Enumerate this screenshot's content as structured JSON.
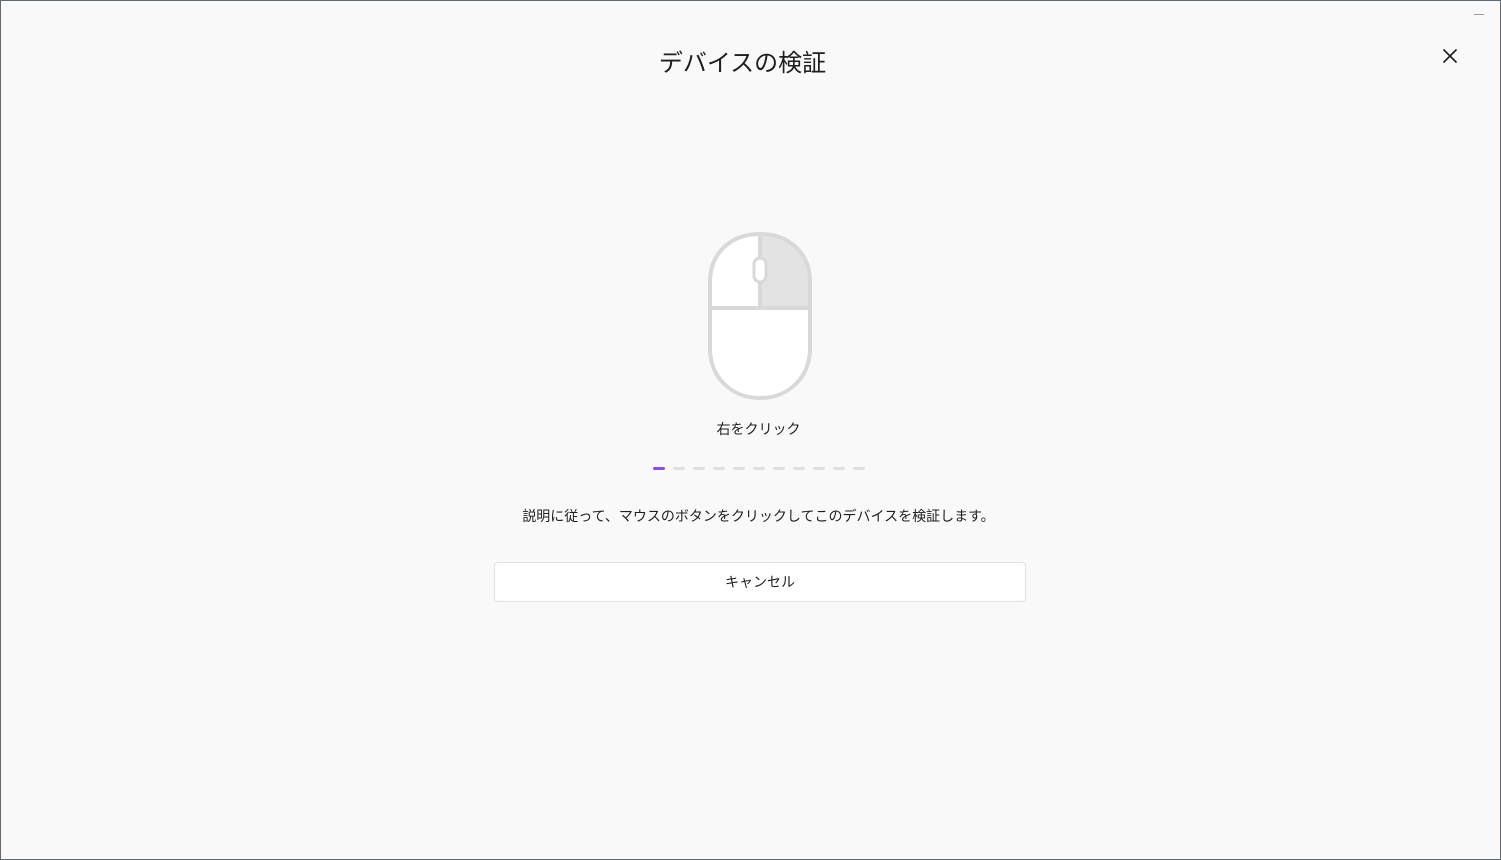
{
  "dialog": {
    "title": "デバイスの検証",
    "close_icon": "close-icon",
    "minimize_icon": "minimize-icon"
  },
  "mouse": {
    "icon": "mouse-icon",
    "highlighted_button": "right",
    "highlight_color": "#e3e3e3",
    "outline_color": "#d9d9d9"
  },
  "instruction": {
    "caption": "右をクリック",
    "description": "説明に従って、マウスのボタンをクリックしてこのデバイスを検証します。"
  },
  "progress": {
    "total_steps": 11,
    "current_step": 1,
    "active_color": "#8a4fe0",
    "inactive_color": "#e0e0e0"
  },
  "actions": {
    "cancel_label": "キャンセル"
  }
}
